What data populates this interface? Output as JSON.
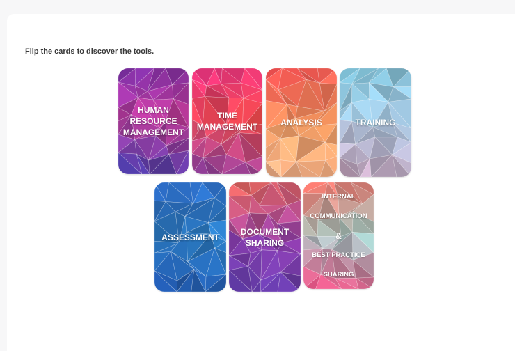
{
  "instruction": "Flip the cards to discover the tools.",
  "cards": [
    {
      "label": "HUMAN\nRESOURCE\nMANAGEMENT",
      "colors": [
        "#7a2fa8",
        "#c23a93",
        "#3e3ba8"
      ]
    },
    {
      "label": "TIME\nMANAGEMENT",
      "colors": [
        "#d92f7b",
        "#ef4a4a",
        "#8a3fa6"
      ]
    },
    {
      "label": "ANALYSIS",
      "colors": [
        "#ef4a4f",
        "#f39a5e",
        "#f5b38a"
      ]
    },
    {
      "label": "TRAINING",
      "colors": [
        "#7cc0d6",
        "#a7c6e0",
        "#c4a0b8"
      ]
    },
    {
      "label": "ASSESSMENT",
      "colors": [
        "#2a62b8",
        "#2b7ec4",
        "#1f4fa0"
      ]
    },
    {
      "label": "DOCUMENT\nSHARING",
      "colors": [
        "#ee6a5c",
        "#8c3aa4",
        "#5c3ba8"
      ]
    },
    {
      "label_lines": [
        "INTERNAL",
        "COMMUNICATION",
        "&",
        "BEST PRACTICE",
        "SHARING"
      ],
      "colors": [
        "#f06a60",
        "#9ad0c8",
        "#e2467a"
      ]
    }
  ]
}
